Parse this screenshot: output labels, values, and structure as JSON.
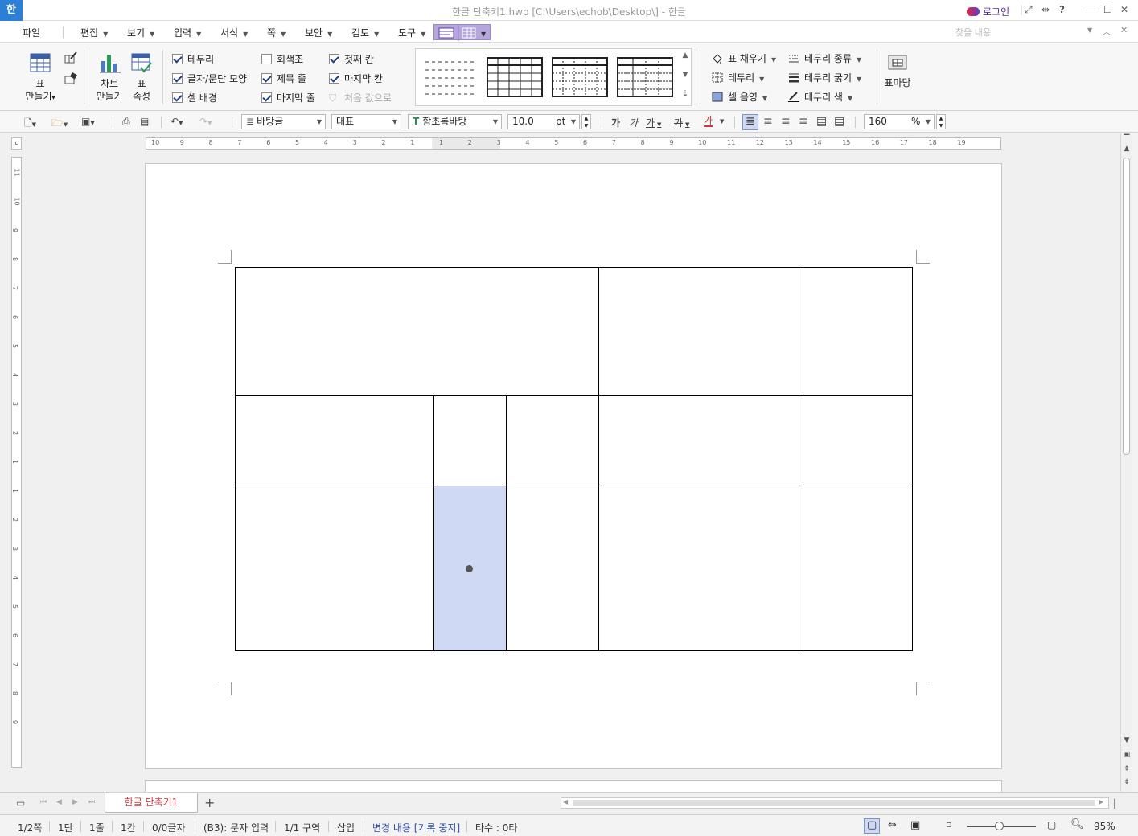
{
  "window": {
    "app_icon": "한",
    "title": "한글 단축키1.hwp [C:\\Users\\echob\\Desktop\\] - 한글",
    "login": "로그인",
    "help": "?",
    "buttons": [
      "minimize-icon",
      "maximize-icon",
      "close-icon"
    ]
  },
  "menu": {
    "file": "파일",
    "items": [
      "편집",
      "보기",
      "입력",
      "서식",
      "쪽",
      "보안",
      "검토",
      "도구"
    ],
    "search_placeholder": "찾을 내용"
  },
  "ribbon": {
    "make_table": "표\n만들기",
    "make_table_l1": "표",
    "make_table_l2": "만들기",
    "chart_l1": "차트",
    "chart_l2": "만들기",
    "props_l1": "표",
    "props_l2": "속성",
    "checks": [
      {
        "label": "테두리",
        "checked": true
      },
      {
        "label": "글자/문단 모양",
        "checked": true
      },
      {
        "label": "셀 배경",
        "checked": true
      },
      {
        "label": "회색조",
        "checked": false
      },
      {
        "label": "제목 줄",
        "checked": true
      },
      {
        "label": "마지막 줄",
        "checked": true
      },
      {
        "label": "첫째 칸",
        "checked": true
      },
      {
        "label": "마지막 칸",
        "checked": true
      }
    ],
    "reset": "처음 값으로",
    "fill": "표 채우기",
    "border": "테두리",
    "cell_shade": "셀 음영",
    "border_type": "테두리 종류",
    "border_width": "테두리 굵기",
    "border_color": "테두리 색",
    "table_mark": "표마당"
  },
  "format": {
    "style": "바탕글",
    "lang": "대표",
    "font": "함초롬바탕",
    "size": "10.0",
    "unit": "pt",
    "line_spacing": "160",
    "line_unit": "%",
    "bold_glyph": "가",
    "italic_glyph": "가",
    "underline_glyph": "가",
    "strike_glyph": "가",
    "color_glyph": "가"
  },
  "ruler": {
    "h_ticks": [
      "10",
      "9",
      "8",
      "7",
      "6",
      "5",
      "4",
      "3",
      "2",
      "1",
      "1",
      "2",
      "3",
      "4",
      "5",
      "6",
      "7",
      "8",
      "9",
      "10",
      "11",
      "12",
      "13",
      "14",
      "15",
      "16",
      "17",
      "18",
      "19"
    ],
    "v_ticks": [
      "11",
      "10",
      "9",
      "8",
      "7",
      "6",
      "5",
      "4",
      "3",
      "2",
      "1",
      "1",
      "2",
      "3",
      "4",
      "5",
      "6",
      "7",
      "8",
      "9"
    ]
  },
  "table": {
    "selected_cell": "B3"
  },
  "tabs": {
    "doc_name": "한글 단축키1",
    "add": "+"
  },
  "status": {
    "page": "1/2쪽",
    "column": "1단",
    "line": "1줄",
    "cell": "1칸",
    "chars": "0/0글자",
    "mode": "(B3): 문자 입력",
    "section": "1/1 구역",
    "insert": "삽입",
    "track": "변경 내용 [기록 중지]",
    "typing": "타수 : 0타",
    "zoom": "95%"
  },
  "colors": {
    "accent_blue": "#2b7fd4",
    "selected_cell": "#cfd9f3",
    "tab_red": "#c9383e",
    "purple_tool": "#b6a6dc"
  }
}
